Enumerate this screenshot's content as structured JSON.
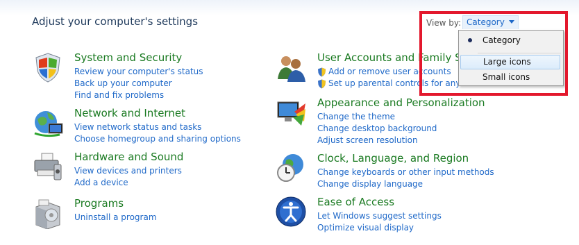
{
  "page_title": "Adjust your computer's settings",
  "view_by": {
    "label": "View by:",
    "selected": "Category",
    "options": [
      "Category",
      "Large icons",
      "Small icons"
    ]
  },
  "categories_left": [
    {
      "title": "System and Security",
      "icon": "shield-flag-icon",
      "links": [
        "Review your computer's status",
        "Back up your computer",
        "Find and fix problems"
      ]
    },
    {
      "title": "Network and Internet",
      "icon": "network-globe-icon",
      "links": [
        "View network status and tasks",
        "Choose homegroup and sharing options"
      ]
    },
    {
      "title": "Hardware and Sound",
      "icon": "printer-icon",
      "links": [
        "View devices and printers",
        "Add a device"
      ]
    },
    {
      "title": "Programs",
      "icon": "programs-box-icon",
      "links": [
        "Uninstall a program"
      ]
    }
  ],
  "categories_right": [
    {
      "title": "User Accounts and Family Saf",
      "icon": "users-icon",
      "links": [
        "Add or remove user accounts",
        "Set up parental controls for any use"
      ]
    },
    {
      "title": "Appearance and Personalization",
      "icon": "monitor-palette-icon",
      "links": [
        "Change the theme",
        "Change desktop background",
        "Adjust screen resolution"
      ]
    },
    {
      "title": "Clock, Language, and Region",
      "icon": "clock-globe-icon",
      "links": [
        "Change keyboards or other input methods",
        "Change display language"
      ]
    },
    {
      "title": "Ease of Access",
      "icon": "ease-of-access-icon",
      "links": [
        "Let Windows suggest settings",
        "Optimize visual display"
      ]
    }
  ],
  "colors": {
    "heading_green": "#1a7a21",
    "link_blue": "#1e68c8",
    "highlight_red": "#e3182d"
  }
}
